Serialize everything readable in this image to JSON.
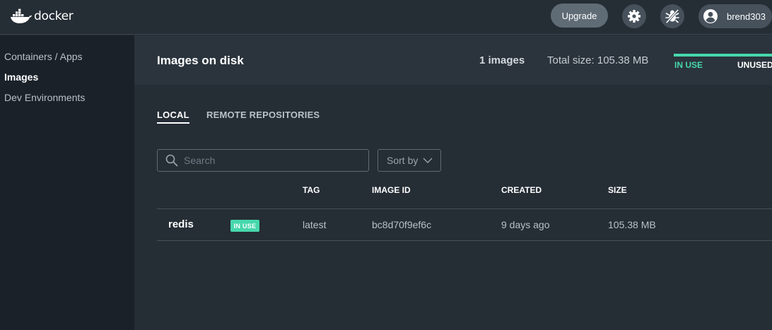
{
  "app": {
    "logo_text": "docker"
  },
  "topbar": {
    "upgrade_label": "Upgrade",
    "settings_icon": "gear-icon",
    "troubleshoot_icon": "bug-icon",
    "user_icon": "user-avatar-icon",
    "username": "brend303"
  },
  "sidebar": {
    "items": [
      {
        "label": "Containers / Apps",
        "active": false
      },
      {
        "label": "Images",
        "active": true
      },
      {
        "label": "Dev Environments",
        "active": false
      }
    ]
  },
  "header": {
    "title": "Images on disk",
    "image_count": "1 images",
    "total_size": "Total size: 105.38 MB",
    "in_use_label": "IN USE",
    "unused_label": "UNUSED"
  },
  "tabs": [
    {
      "label": "LOCAL",
      "active": true
    },
    {
      "label": "REMOTE REPOSITORIES",
      "active": false
    }
  ],
  "search": {
    "placeholder": "Search",
    "value": ""
  },
  "sort": {
    "label": "Sort by"
  },
  "table": {
    "columns": [
      "TAG",
      "IMAGE ID",
      "CREATED",
      "SIZE"
    ],
    "rows": [
      {
        "name": "redis",
        "badge": "IN USE",
        "tag": "latest",
        "image_id": "bc8d70f9ef6c",
        "created": "9 days ago",
        "size": "105.38 MB"
      }
    ]
  },
  "colors": {
    "accent": "#47d7ac",
    "background": "#252d35",
    "sidebar": "#1a2129"
  }
}
